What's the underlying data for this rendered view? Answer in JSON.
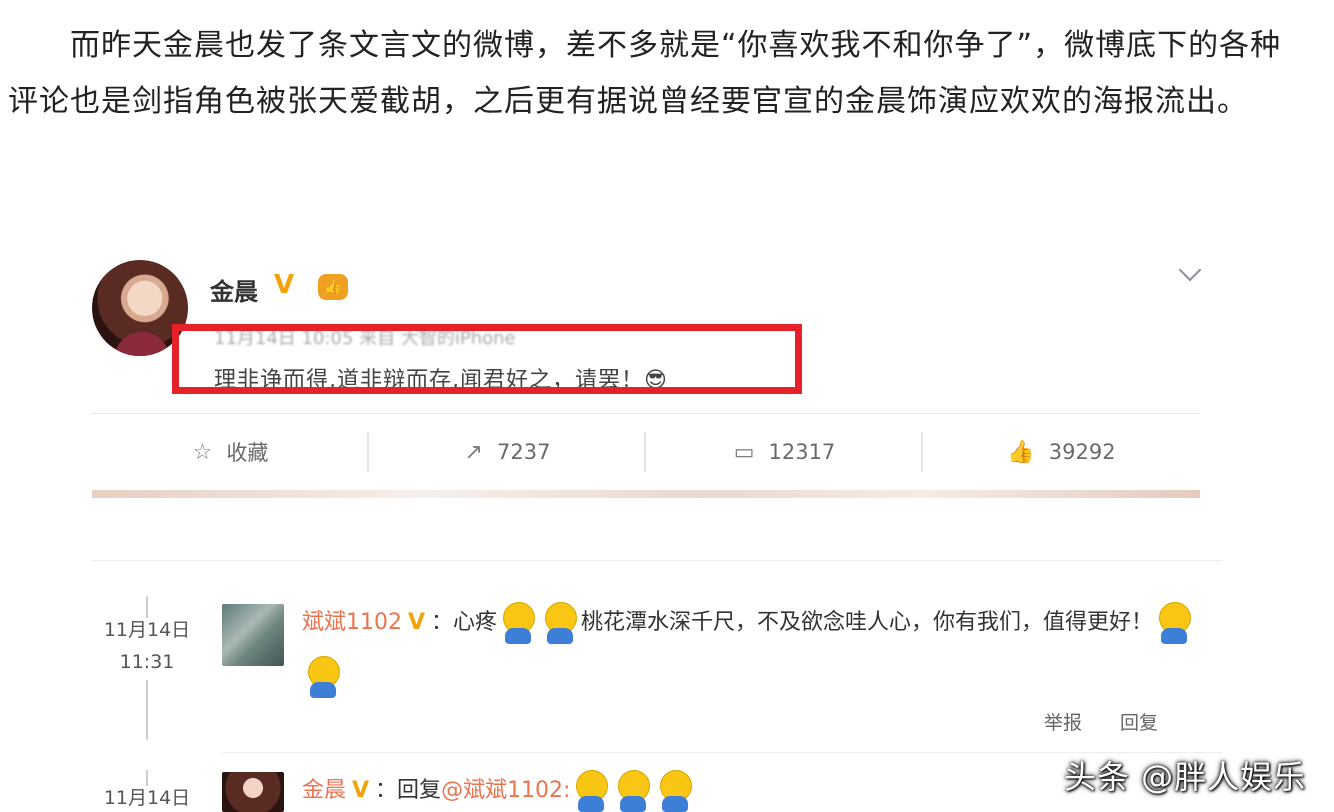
{
  "article": {
    "paragraph": "而昨天金晨也发了条文言文的微博，差不多就是“你喜欢我不和你争了”，微博底下的各种评论也是剑指角色被张天爱截胡，之后更有据说曾经要官宣的金晨饰演应欢欢的海报流出。"
  },
  "post": {
    "username": "金晨",
    "verified": "V",
    "vip_badge": "👍",
    "meta": "11月14日 10:05 来自 大智的iPhone",
    "content": "理非诤而得,道非辩而存,闻君好之，请罢！😎",
    "highlight_color": "#e5212a",
    "actions": {
      "favorite_label": "收藏",
      "repost_count": "7237",
      "comment_count": "12317",
      "like_count": "39292"
    },
    "icons": {
      "favorite": "star-icon",
      "repost": "share-icon",
      "comment": "comment-icon",
      "like": "thumbs-up-icon"
    }
  },
  "comments": [
    {
      "date": "11月14日",
      "time": "11:31",
      "username": "斌斌1102",
      "verified": "V",
      "text_before": "：心疼",
      "text_after": "桃花潭水深千尺，不及欲念哇人心，你有我们，值得更好！",
      "report_label": "举报",
      "reply_label": "回复"
    },
    {
      "date": "11月14日",
      "username": "金晨",
      "verified": "V",
      "text_before": "：回复",
      "mention": "@斌斌1102:"
    }
  ],
  "watermark": "头条 @胖人娱乐",
  "colors": {
    "name_link": "#eb7350",
    "verified": "#f2a30a"
  }
}
